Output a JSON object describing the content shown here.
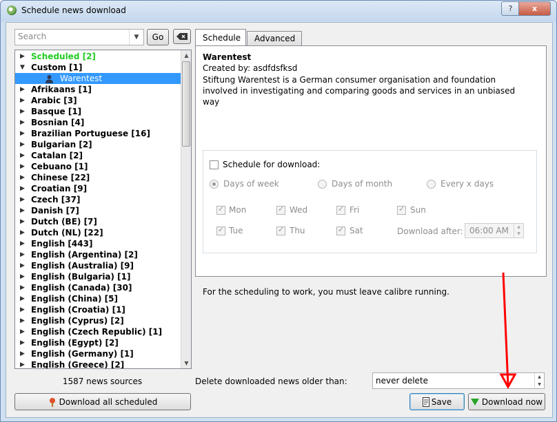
{
  "window": {
    "title": "Schedule news download",
    "help_label": "?",
    "close_label": "x"
  },
  "search": {
    "placeholder": "Search",
    "go_label": "Go"
  },
  "tree": {
    "items": [
      {
        "arrow": "▶",
        "label": "Scheduled [2]",
        "style": "green"
      },
      {
        "arrow": "▼",
        "label": "Custom [1]",
        "style": ""
      },
      {
        "arrow": "",
        "label": "Warentest",
        "style": "selected"
      },
      {
        "arrow": "▶",
        "label": "Afrikaans [1]",
        "style": ""
      },
      {
        "arrow": "▶",
        "label": "Arabic [3]",
        "style": ""
      },
      {
        "arrow": "▶",
        "label": "Basque [1]",
        "style": ""
      },
      {
        "arrow": "▶",
        "label": "Bosnian [4]",
        "style": ""
      },
      {
        "arrow": "▶",
        "label": "Brazilian Portuguese [16]",
        "style": ""
      },
      {
        "arrow": "▶",
        "label": "Bulgarian [2]",
        "style": ""
      },
      {
        "arrow": "▶",
        "label": "Catalan [2]",
        "style": ""
      },
      {
        "arrow": "▶",
        "label": "Cebuano [1]",
        "style": ""
      },
      {
        "arrow": "▶",
        "label": "Chinese [22]",
        "style": ""
      },
      {
        "arrow": "▶",
        "label": "Croatian [9]",
        "style": ""
      },
      {
        "arrow": "▶",
        "label": "Czech [37]",
        "style": ""
      },
      {
        "arrow": "▶",
        "label": "Danish [7]",
        "style": ""
      },
      {
        "arrow": "▶",
        "label": "Dutch (BE) [7]",
        "style": ""
      },
      {
        "arrow": "▶",
        "label": "Dutch (NL) [22]",
        "style": ""
      },
      {
        "arrow": "▶",
        "label": "English [443]",
        "style": ""
      },
      {
        "arrow": "▶",
        "label": "English (Argentina) [2]",
        "style": ""
      },
      {
        "arrow": "▶",
        "label": "English (Australia) [9]",
        "style": ""
      },
      {
        "arrow": "▶",
        "label": "English (Bulgaria) [1]",
        "style": ""
      },
      {
        "arrow": "▶",
        "label": "English (Canada) [30]",
        "style": ""
      },
      {
        "arrow": "▶",
        "label": "English (China) [5]",
        "style": ""
      },
      {
        "arrow": "▶",
        "label": "English (Croatia) [1]",
        "style": ""
      },
      {
        "arrow": "▶",
        "label": "English (Cyprus) [2]",
        "style": ""
      },
      {
        "arrow": "▶",
        "label": "English (Czech Republic) [1]",
        "style": ""
      },
      {
        "arrow": "▶",
        "label": "English (Egypt) [2]",
        "style": ""
      },
      {
        "arrow": "▶",
        "label": "English (Germany) [1]",
        "style": ""
      },
      {
        "arrow": "▶",
        "label": "English (Greece) [2]",
        "style": ""
      }
    ]
  },
  "news_count": "1587 news sources",
  "download_all_label": "Download all scheduled",
  "tabs": [
    {
      "label": "Schedule"
    },
    {
      "label": "Advanced"
    }
  ],
  "recipe": {
    "title": "Warentest",
    "created_by": "Created by: asdfdsfksd",
    "description": "Stiftung Warentest is a German consumer organisation and foundation involved in investigating and comparing goods and services in an unbiased way"
  },
  "schedule": {
    "schedule_label": "Schedule for download:",
    "radios": {
      "days_of_week": "Days of  week",
      "days_of_month": "Days of month",
      "every_x_days": "Every x days"
    },
    "days": {
      "mon": "Mon",
      "wed": "Wed",
      "fri": "Fri",
      "sun": "Sun",
      "tue": "Tue",
      "thu": "Thu",
      "sat": "Sat"
    },
    "download_after_label": "Download after:",
    "download_after_value": "06:00 AM",
    "note": "For the scheduling to work, you must leave calibre running."
  },
  "delete_old": {
    "label": "Delete downloaded news older than:",
    "value": "never delete"
  },
  "buttons": {
    "save": "Save",
    "download_now": "Download now"
  },
  "colors": {
    "scheduled_green": "#22cc22",
    "selection_blue": "#3399ff",
    "annotation_red": "#ff0000"
  }
}
